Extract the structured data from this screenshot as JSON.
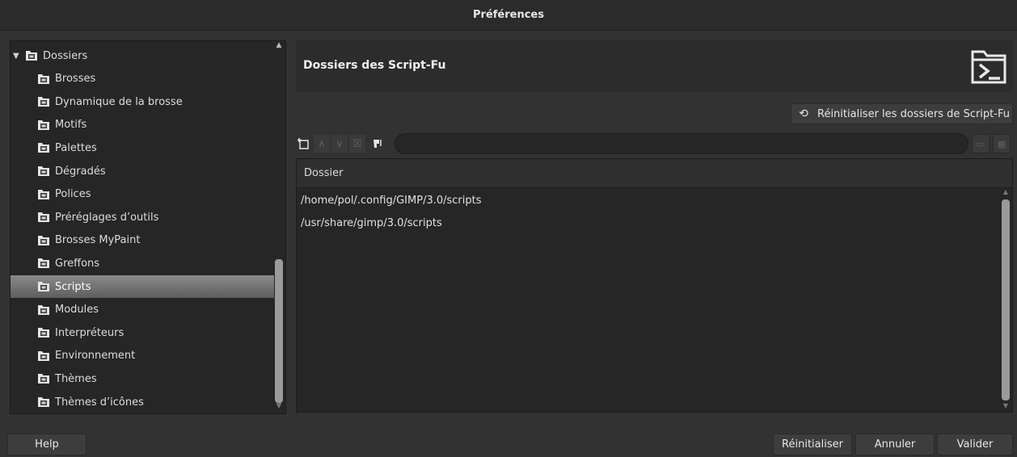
{
  "window": {
    "title": "Préférences"
  },
  "sidebar": {
    "items": [
      {
        "label": "Dossiers",
        "icon": "folders-icon",
        "expanded": true,
        "level": 0
      },
      {
        "label": "Brosses",
        "icon": "brush-folder-icon",
        "level": 1
      },
      {
        "label": "Dynamique de la brosse",
        "icon": "dynamics-folder-icon",
        "level": 1
      },
      {
        "label": "Motifs",
        "icon": "pattern-folder-icon",
        "level": 1
      },
      {
        "label": "Palettes",
        "icon": "palette-folder-icon",
        "level": 1
      },
      {
        "label": "Dégradés",
        "icon": "gradient-folder-icon",
        "level": 1
      },
      {
        "label": "Polices",
        "icon": "font-folder-icon",
        "level": 1
      },
      {
        "label": "Préréglages d’outils",
        "icon": "tool-preset-folder-icon",
        "level": 1
      },
      {
        "label": "Brosses MyPaint",
        "icon": "mypaint-folder-icon",
        "level": 1
      },
      {
        "label": "Greffons",
        "icon": "plugin-folder-icon",
        "level": 1
      },
      {
        "label": "Scripts",
        "icon": "script-folder-icon",
        "level": 1,
        "selected": true
      },
      {
        "label": "Modules",
        "icon": "module-folder-icon",
        "level": 1
      },
      {
        "label": "Interpréteurs",
        "icon": "interpreter-folder-icon",
        "level": 1
      },
      {
        "label": "Environnement",
        "icon": "environment-folder-icon",
        "level": 1
      },
      {
        "label": "Thèmes",
        "icon": "theme-folder-icon",
        "level": 1
      },
      {
        "label": "Thèmes d’icônes",
        "icon": "icon-theme-folder-icon",
        "level": 1
      }
    ]
  },
  "main": {
    "title": "Dossiers des Script-Fu",
    "reset_folders_label": "Réinitialiser les dossiers de Script-Fu",
    "path_value": "",
    "column_header": "Dossier",
    "folders": [
      "/home/pol/.config/GIMP/3.0/scripts",
      "/usr/share/gimp/3.0/scripts"
    ]
  },
  "footer": {
    "help_label": "Help",
    "reset_label": "Réinitialiser",
    "cancel_label": "Annuler",
    "ok_label": "Valider"
  },
  "colors": {
    "background": "#323232",
    "panel": "#262626",
    "selection": "#7a7a7a"
  }
}
